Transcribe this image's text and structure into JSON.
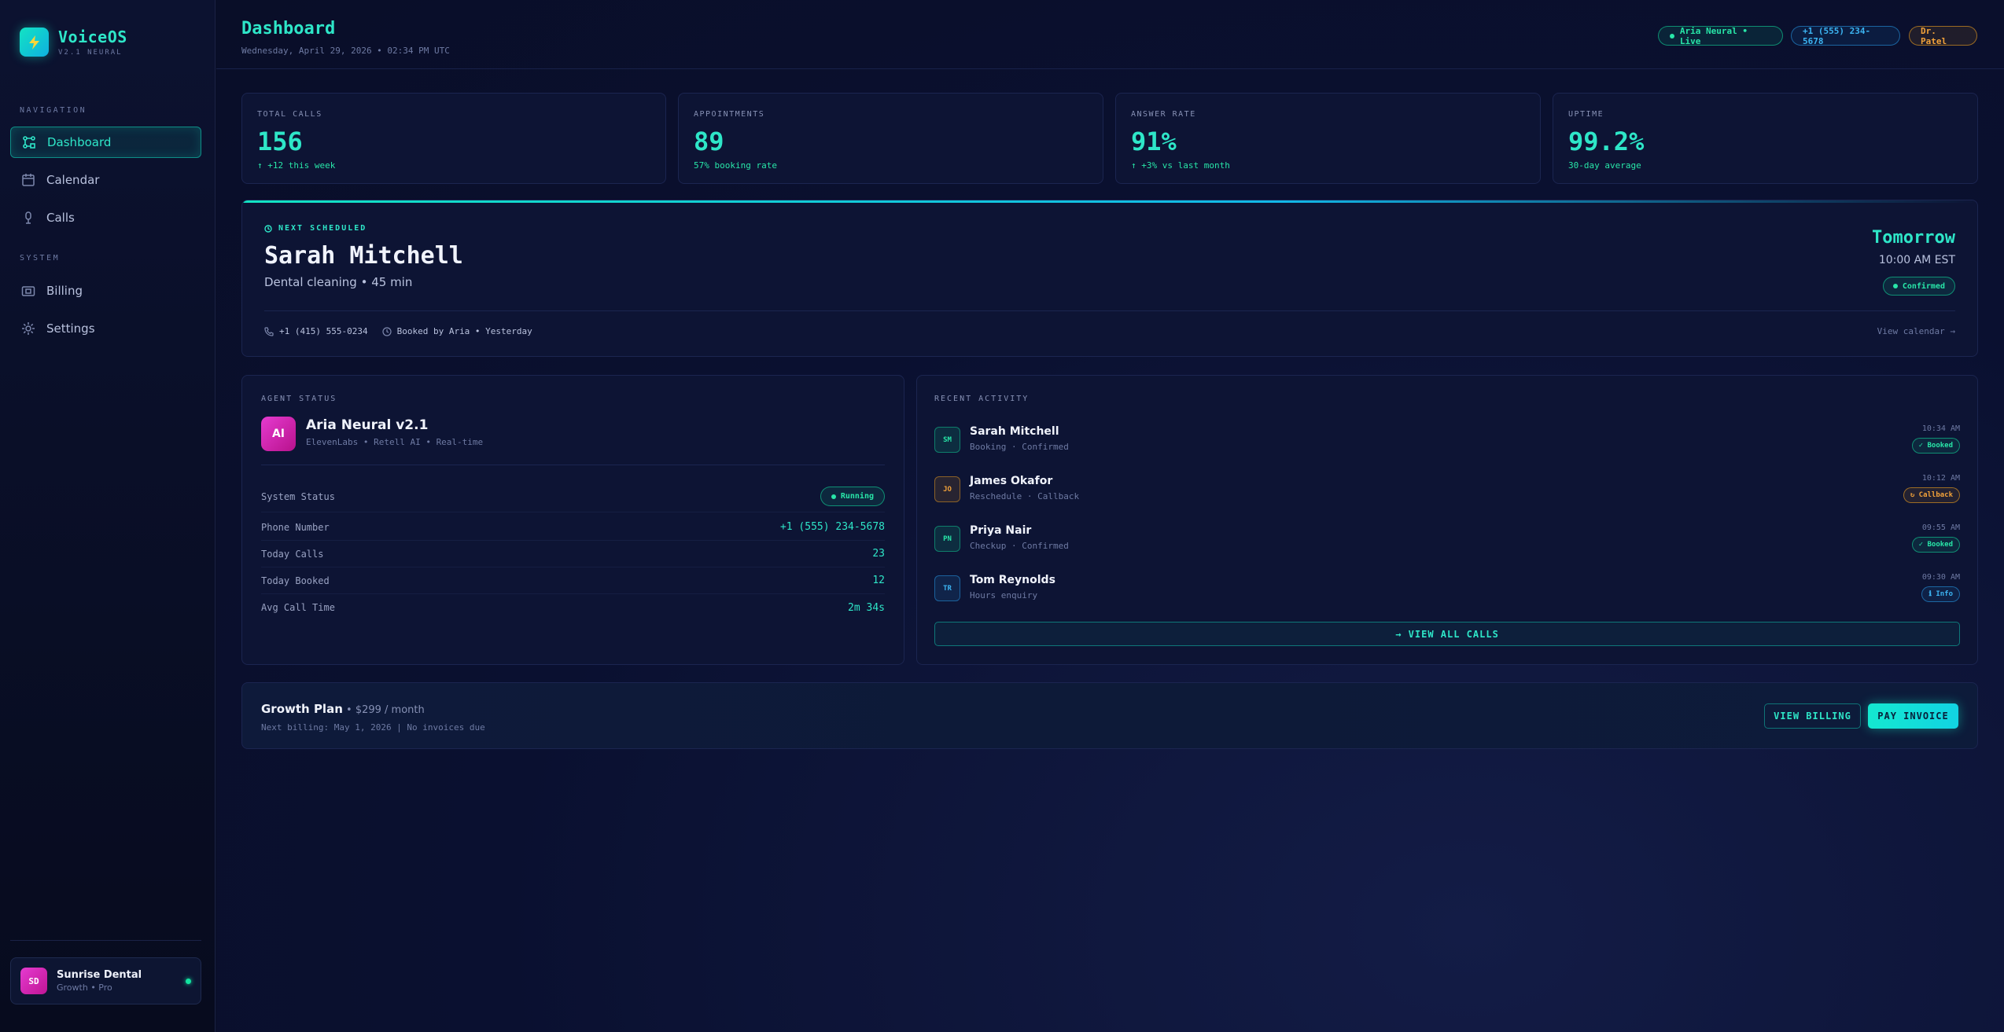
{
  "brand": {
    "name": "VoiceOS",
    "version": "V2.1 NEURAL"
  },
  "nav": {
    "section_navigation": "NAVIGATION",
    "section_system": "SYSTEM",
    "items": [
      {
        "label": "Dashboard",
        "icon": "dashboard-icon"
      },
      {
        "label": "Calendar",
        "icon": "calendar-icon"
      },
      {
        "label": "Calls",
        "icon": "microphone-icon"
      },
      {
        "label": "Billing",
        "icon": "billing-icon"
      },
      {
        "label": "Settings",
        "icon": "gear-icon"
      }
    ],
    "active": "Dashboard"
  },
  "account": {
    "initials": "SD",
    "name": "Sunrise Dental",
    "plan": "Growth • Pro"
  },
  "header": {
    "title": "Dashboard",
    "date": "Wednesday, April 29, 2026 • 02:34 PM UTC",
    "agent_pill": "Aria Neural • Live",
    "phone_pill": "+1 (555) 234-5678",
    "user_pill": "Dr. Patel"
  },
  "stats": [
    {
      "label": "TOTAL CALLS",
      "value": "156",
      "sub": "↑ +12 this week"
    },
    {
      "label": "APPOINTMENTS",
      "value": "89",
      "sub": "57% booking rate"
    },
    {
      "label": "ANSWER RATE",
      "value": "91%",
      "sub": "↑ +3% vs last month"
    },
    {
      "label": "UPTIME",
      "value": "99.2%",
      "sub": "30-day average"
    }
  ],
  "next": {
    "kicker": "NEXT SCHEDULED",
    "name": "Sarah Mitchell",
    "service": "Dental cleaning • 45 min",
    "when": "Tomorrow",
    "time": "10:00 AM EST",
    "status": "Confirmed",
    "phone": "+1 (415) 555-0234",
    "booked_by": "Booked by Aria • Yesterday",
    "link": "View calendar →"
  },
  "agent": {
    "section": "AGENT STATUS",
    "avatar": "AI",
    "name": "Aria Neural v2.1",
    "desc": "ElevenLabs • Retell AI • Real-time",
    "system_status_label": "System Status",
    "system_status": "Running",
    "rows": [
      {
        "key": "Phone Number",
        "value": "+1 (555) 234-5678"
      },
      {
        "key": "Today Calls",
        "value": "23"
      },
      {
        "key": "Today Booked",
        "value": "12"
      },
      {
        "key": "Avg Call Time",
        "value": "2m 34s"
      }
    ]
  },
  "activity": {
    "section": "RECENT ACTIVITY",
    "items": [
      {
        "initials": "SM",
        "name": "Sarah Mitchell",
        "desc": "Booking · Confirmed",
        "time": "10:34 AM",
        "badge": "✓ Booked"
      },
      {
        "initials": "JO",
        "name": "James Okafor",
        "desc": "Reschedule · Callback",
        "time": "10:12 AM",
        "badge": "↻ Callback"
      },
      {
        "initials": "PN",
        "name": "Priya Nair",
        "desc": "Checkup · Confirmed",
        "time": "09:55 AM",
        "badge": "✓ Booked"
      },
      {
        "initials": "TR",
        "name": "Tom Reynolds",
        "desc": "Hours enquiry",
        "time": "09:30 AM",
        "badge": "ℹ Info"
      }
    ],
    "view_all": "→ VIEW ALL CALLS"
  },
  "plan": {
    "name": "Growth Plan",
    "price": " • $299 / month",
    "sub": "Next billing: May 1, 2026 | No invoices due",
    "view_billing": "VIEW BILLING",
    "pay_invoice": "PAY INVOICE"
  },
  "colors": {
    "accent": "#2ee6c8",
    "success": "#28e6a8",
    "warning": "#f2a23a",
    "info": "#3cb4f2",
    "magenta": "#e53bd0"
  }
}
